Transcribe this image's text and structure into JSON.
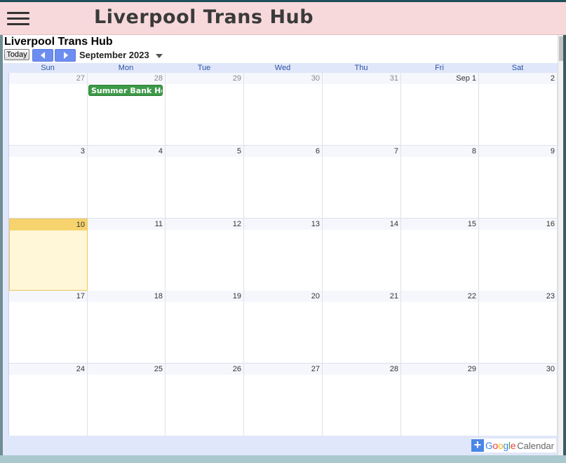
{
  "header": {
    "title": "Liverpool Trans Hub"
  },
  "calendar": {
    "title": "Liverpool Trans Hub",
    "today_label": "Today",
    "month_label": "September 2023",
    "weekdays": [
      "Sun",
      "Mon",
      "Tue",
      "Wed",
      "Thu",
      "Fri",
      "Sat"
    ],
    "weeks": [
      [
        {
          "label": "27",
          "other": true
        },
        {
          "label": "28",
          "other": true,
          "event": "Summer Bank Holi"
        },
        {
          "label": "29",
          "other": true
        },
        {
          "label": "30",
          "other": true
        },
        {
          "label": "31",
          "other": true
        },
        {
          "label": "Sep 1"
        },
        {
          "label": "2"
        }
      ],
      [
        {
          "label": "3"
        },
        {
          "label": "4"
        },
        {
          "label": "5"
        },
        {
          "label": "6"
        },
        {
          "label": "7"
        },
        {
          "label": "8"
        },
        {
          "label": "9"
        }
      ],
      [
        {
          "label": "10",
          "today": true
        },
        {
          "label": "11"
        },
        {
          "label": "12"
        },
        {
          "label": "13"
        },
        {
          "label": "14"
        },
        {
          "label": "15"
        },
        {
          "label": "16"
        }
      ],
      [
        {
          "label": "17"
        },
        {
          "label": "18"
        },
        {
          "label": "19"
        },
        {
          "label": "20"
        },
        {
          "label": "21"
        },
        {
          "label": "22"
        },
        {
          "label": "23"
        }
      ],
      [
        {
          "label": "24"
        },
        {
          "label": "25"
        },
        {
          "label": "26"
        },
        {
          "label": "27"
        },
        {
          "label": "28"
        },
        {
          "label": "29"
        },
        {
          "label": "30"
        }
      ]
    ],
    "event_color": "#3d9a48",
    "today_color": "#f7d36d"
  },
  "footer": {
    "badge_google": [
      "G",
      "o",
      "o",
      "g",
      "l",
      "e"
    ],
    "badge_calendar": "Calendar",
    "badge_icon": "plus-icon"
  }
}
